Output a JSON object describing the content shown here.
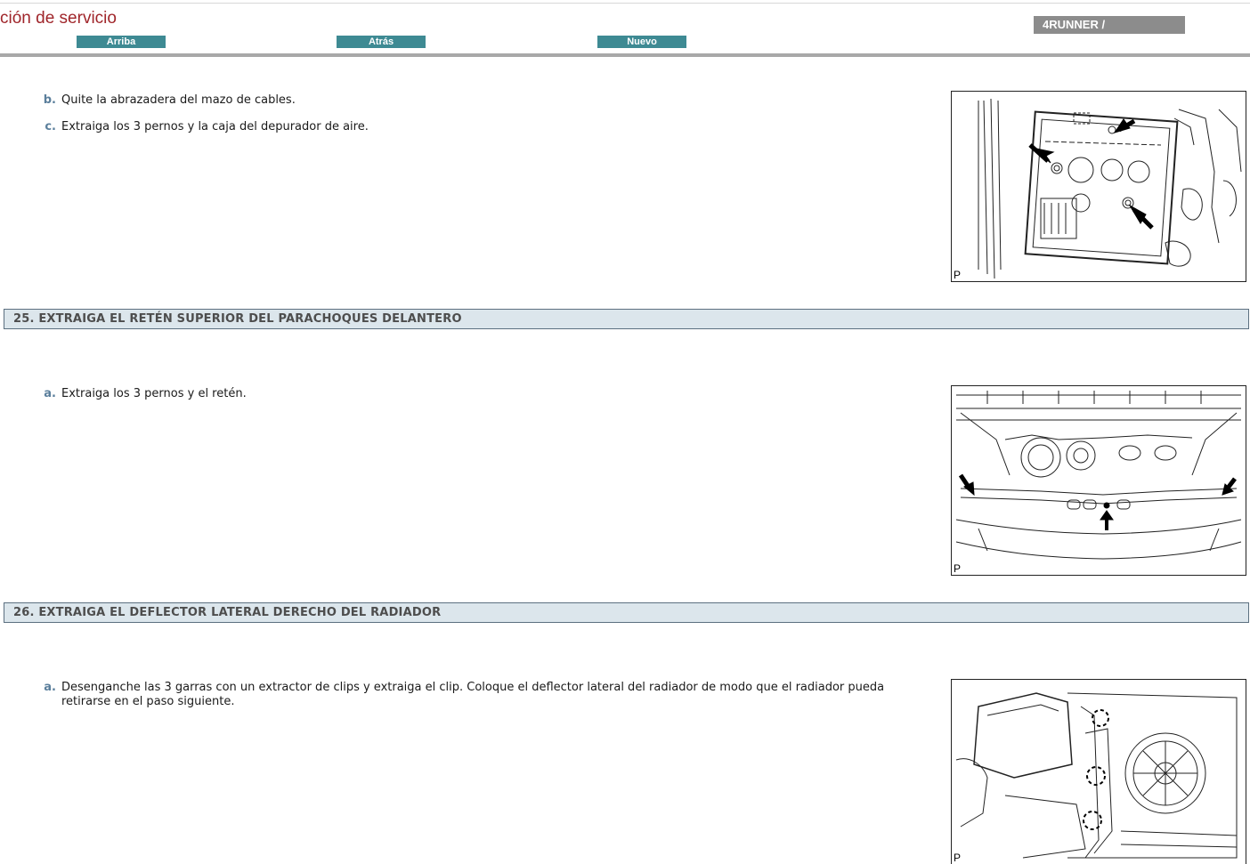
{
  "header": {
    "title": "ción de servicio",
    "nav": {
      "top": "Arriba",
      "back": "Atrás",
      "new": "Nuevo"
    },
    "model": "4RUNNER /"
  },
  "steps": [
    {
      "letter": "b.",
      "text": "Quite la abrazadera del mazo de cables."
    },
    {
      "letter": "c.",
      "text": "Extraiga los 3 pernos y la caja del depurador de aire."
    }
  ],
  "sections": [
    {
      "heading": "25. EXTRAIGA EL RETÉN SUPERIOR DEL PARACHOQUES DELANTERO",
      "steps": [
        {
          "letter": "a.",
          "text": "Extraiga los 3 pernos y el retén."
        }
      ]
    },
    {
      "heading": "26. EXTRAIGA EL DEFLECTOR LATERAL DERECHO DEL RADIADOR",
      "steps": [
        {
          "letter": "a.",
          "text": "Desenganche las 3 garras con un extractor de clips y extraiga el clip. Coloque el deflector lateral del radiador de modo que el radiador pueda\nretirarse en el paso siguiente."
        }
      ]
    }
  ],
  "figures": [
    {
      "label": "P"
    },
    {
      "label": "P"
    },
    {
      "label": "P"
    }
  ]
}
